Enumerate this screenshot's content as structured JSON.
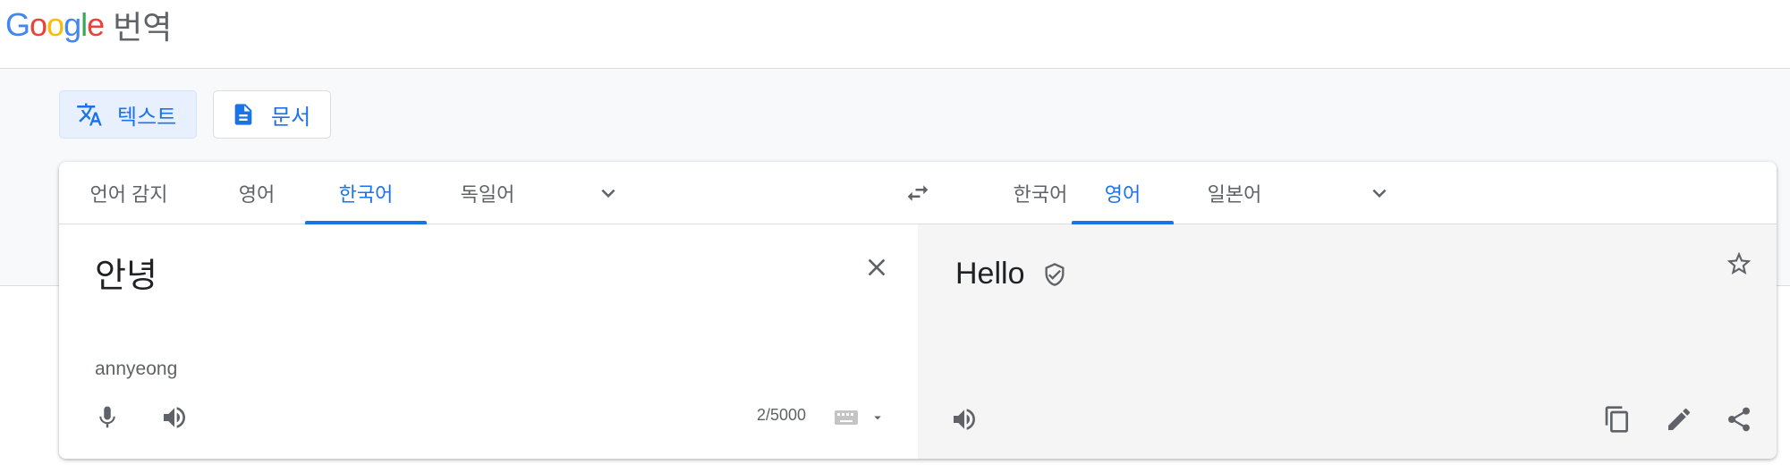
{
  "header": {
    "logo_text": "Google",
    "product_name": "번역"
  },
  "modes": [
    {
      "label": "텍스트",
      "icon": "translate-icon",
      "active": true
    },
    {
      "label": "문서",
      "icon": "document-icon",
      "active": false
    }
  ],
  "source_languages": {
    "tabs": [
      "언어 감지",
      "영어",
      "한국어",
      "독일어"
    ],
    "selected": "한국어"
  },
  "target_languages": {
    "tabs": [
      "한국어",
      "영어",
      "일본어"
    ],
    "selected": "영어"
  },
  "source": {
    "text": "안녕",
    "transliteration": "annyeong",
    "char_count": "2/5000"
  },
  "target": {
    "text": "Hello"
  },
  "colors": {
    "accent": "#1a73e8",
    "active_bg": "#e8f0fe",
    "icon_gray": "#5f6368",
    "target_bg": "#f5f5f5"
  }
}
